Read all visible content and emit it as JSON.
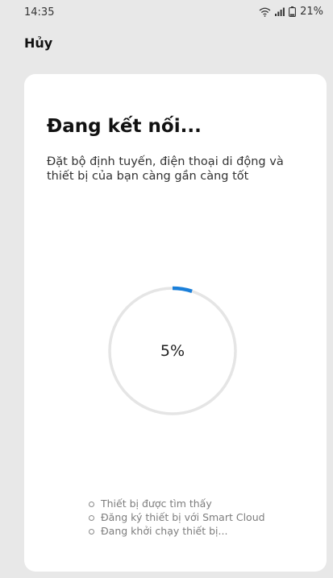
{
  "status_bar": {
    "time": "14:35",
    "battery": "21%",
    "icons": [
      "wifi-icon",
      "signal-icon",
      "battery-icon"
    ]
  },
  "header": {
    "cancel_label": "Hủy"
  },
  "card": {
    "title": "Đang kết nối...",
    "description": "Đặt bộ định tuyến, điện thoại di động và thiết bị của bạn càng gần càng tốt"
  },
  "progress": {
    "value": 0.05,
    "label": "5%",
    "track_color": "#e5e5e5",
    "fill_color": "#1a7fd9"
  },
  "steps": [
    {
      "label": "Thiết bị được tìm thấy"
    },
    {
      "label": "Đăng ký thiết bị với Smart Cloud"
    },
    {
      "label": "Đang khởi chạy thiết bị..."
    }
  ]
}
